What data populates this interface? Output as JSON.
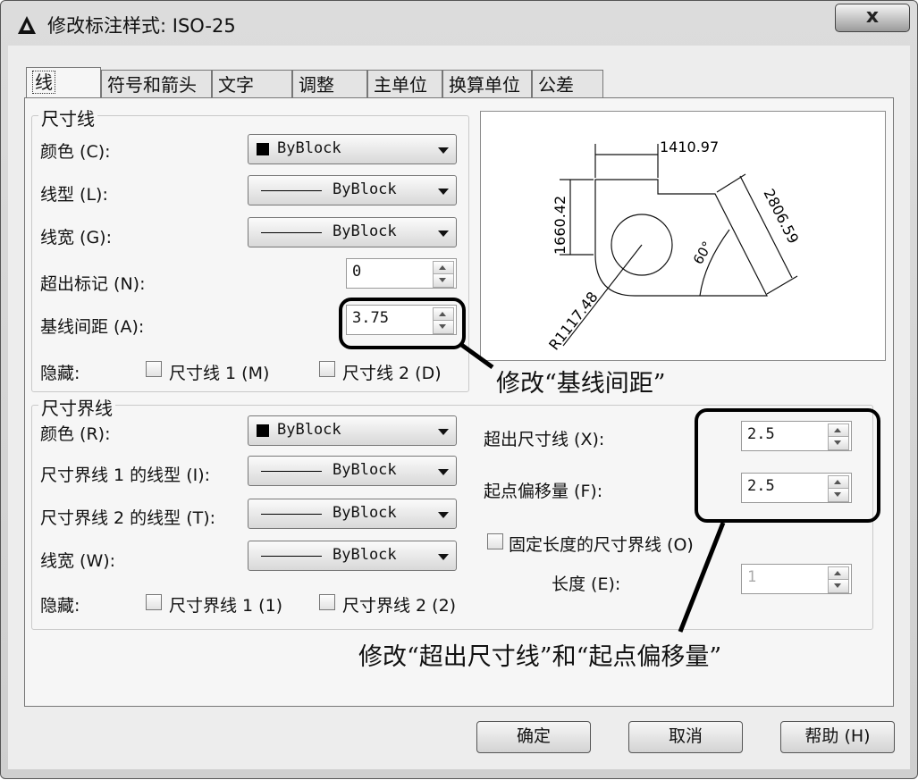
{
  "window": {
    "title": "修改标注样式: ISO-25",
    "close_glyph": "x"
  },
  "tabs": [
    "线",
    "符号和箭头",
    "文字",
    "调整",
    "主单位",
    "换算单位",
    "公差"
  ],
  "dim_line": {
    "group_label": "尺寸线",
    "color_label": "颜色 (C):",
    "color_value": "ByBlock",
    "linetype_label": "线型 (L):",
    "linetype_value": "ByBlock",
    "lineweight_label": "线宽 (G):",
    "lineweight_value": "ByBlock",
    "extend_ticks_label": "超出标记 (N):",
    "extend_ticks_value": "0",
    "baseline_spacing_label": "基线间距 (A):",
    "baseline_spacing_value": "3.75",
    "suppress_label": "隐藏:",
    "suppress_1": "尺寸线 1 (M)",
    "suppress_2": "尺寸线 2 (D)"
  },
  "ext_line": {
    "group_label": "尺寸界线",
    "color_label": "颜色 (R):",
    "color_value": "ByBlock",
    "linetype1_label": "尺寸界线 1 的线型 (I):",
    "linetype1_value": "ByBlock",
    "linetype2_label": "尺寸界线 2 的线型 (T):",
    "linetype2_value": "ByBlock",
    "lineweight_label": "线宽 (W):",
    "lineweight_value": "ByBlock",
    "suppress_label": "隐藏:",
    "suppress_1": "尺寸界线 1 (1)",
    "suppress_2": "尺寸界线 2 (2)",
    "extend_beyond_label": "超出尺寸线 (X):",
    "extend_beyond_value": "2.5",
    "offset_label": "起点偏移量 (F):",
    "offset_value": "2.5",
    "fixed_length_label": "固定长度的尺寸界线 (O)",
    "length_label": "长度 (E):",
    "length_value": "1"
  },
  "preview": {
    "dim_top": "1410.97",
    "dim_left": "1660.42",
    "dim_aligned": "2806.59",
    "dim_angle": "60°",
    "dim_radius": "R1117.48"
  },
  "annotations": {
    "note1": "修改“基线间距”",
    "note2": "修改“超出尺寸线”和“起点偏移量”"
  },
  "buttons": {
    "ok": "确定",
    "cancel": "取消",
    "help": "帮助 (H)"
  }
}
